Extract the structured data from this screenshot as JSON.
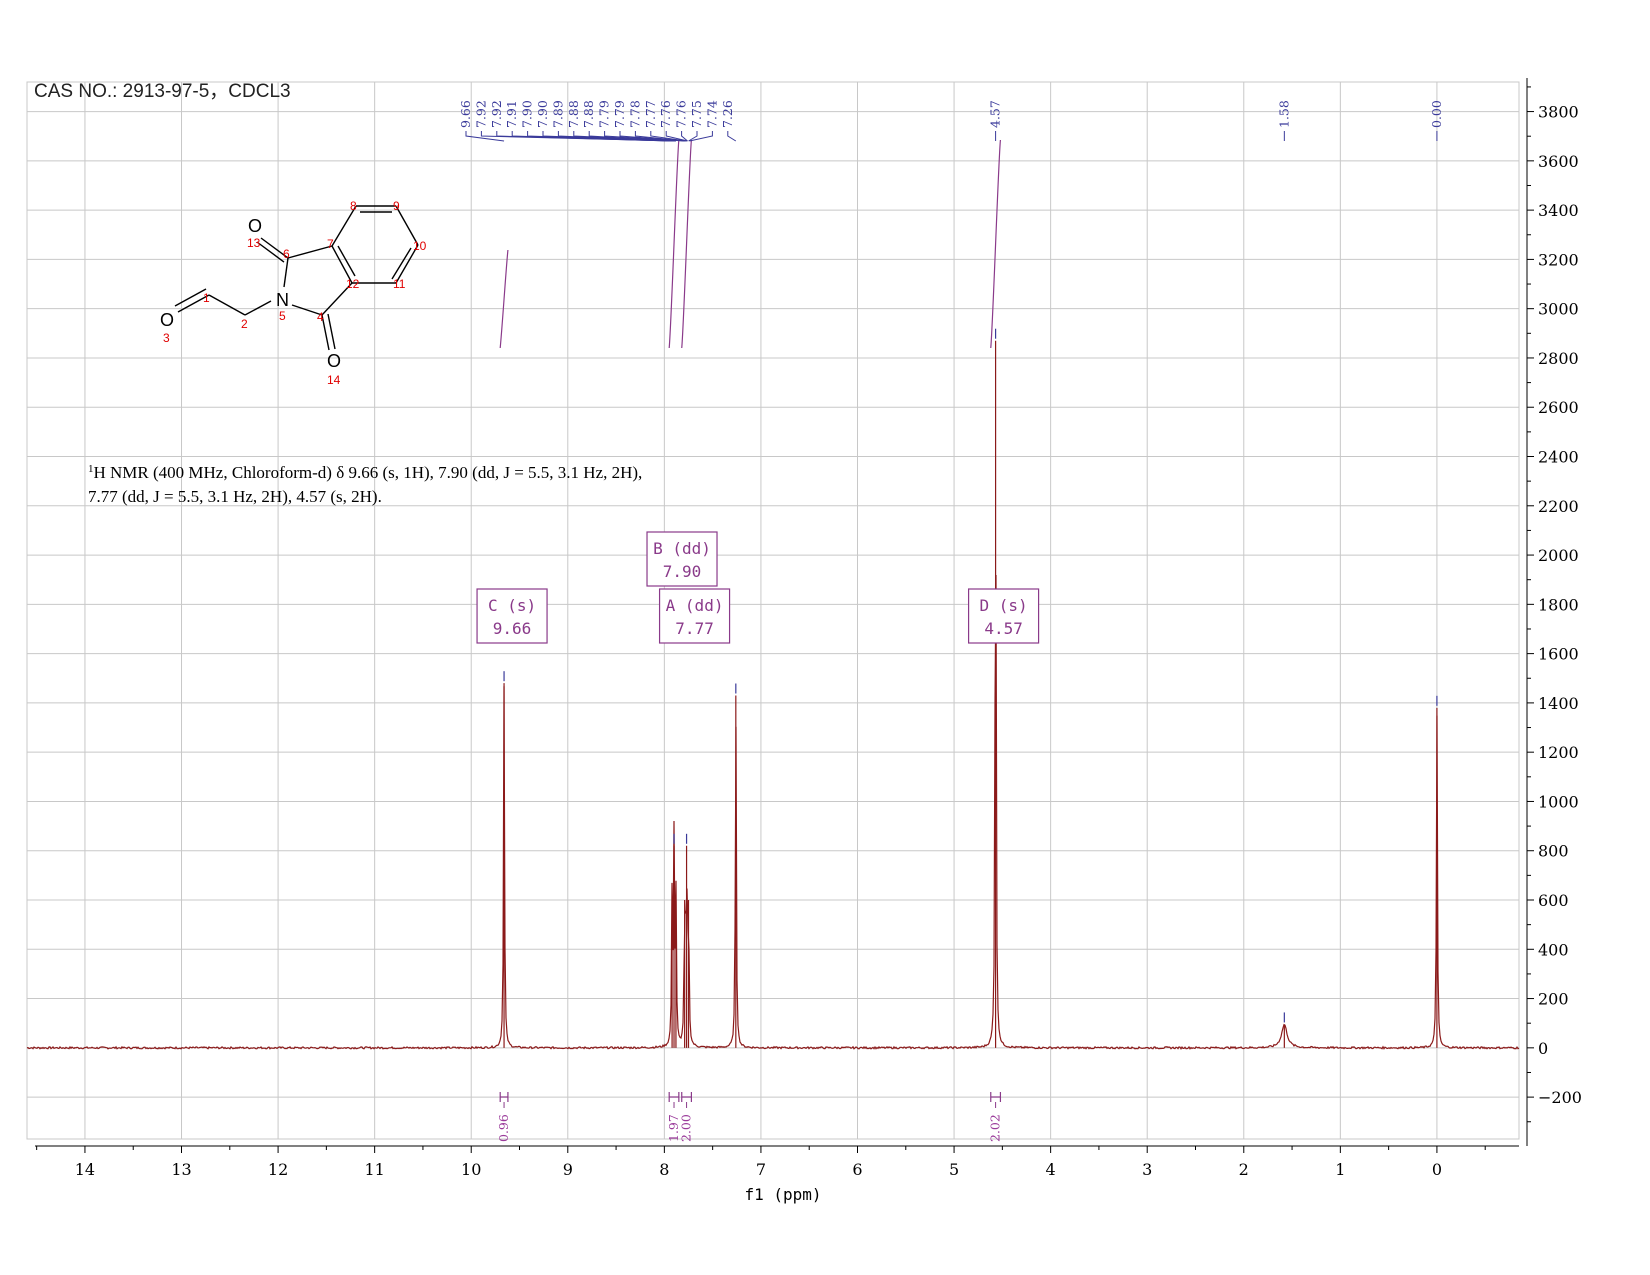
{
  "title": "CAS NO.: 2913-97-5，CDCL3",
  "nmr_description": {
    "line1": "H NMR (400 MHz, Chloroform-d) δ 9.66 (s, 1H), 7.90 (dd, J = 5.5, 3.1 Hz, 2H),",
    "line1_superscript": "1",
    "line2": "7.77 (dd, J = 5.5, 3.1 Hz, 2H), 4.57 (s, 2H)."
  },
  "molecule": {
    "atoms": [
      "O",
      "O",
      "O",
      "N"
    ],
    "numbers": [
      "1",
      "2",
      "3",
      "4",
      "5",
      "6",
      "7",
      "8",
      "9",
      "10",
      "11",
      "12",
      "13",
      "14"
    ]
  },
  "colors": {
    "spectrum": "#8b1a1a",
    "peak_label": "#3a3a9a",
    "integral": "#9a3a9a",
    "grid": "#c8c8c8",
    "atom_number": "#e00000"
  },
  "chart_data": {
    "type": "line",
    "xlabel": "f1 (ppm)",
    "xlim": [
      14.6,
      -0.85
    ],
    "ylim": [
      -370,
      3920
    ],
    "x_reversed": true,
    "x_ticks": [
      "14",
      "13",
      "12",
      "11",
      "10",
      "9",
      "8",
      "7",
      "6",
      "5",
      "4",
      "3",
      "2",
      "1",
      "0"
    ],
    "y_ticks": [
      "3800",
      "3600",
      "3400",
      "3200",
      "3000",
      "2800",
      "2600",
      "2400",
      "2200",
      "2000",
      "1800",
      "1600",
      "1400",
      "1200",
      "1000",
      "800",
      "600",
      "400",
      "200",
      "0",
      "−200"
    ],
    "grid": true,
    "peaks": [
      {
        "ppm": 9.66,
        "height": 1480
      },
      {
        "ppm": 7.92,
        "height": 600
      },
      {
        "ppm": 7.9,
        "height": 820
      },
      {
        "ppm": 7.88,
        "height": 600
      },
      {
        "ppm": 7.79,
        "height": 600
      },
      {
        "ppm": 7.77,
        "height": 820
      },
      {
        "ppm": 7.75,
        "height": 600
      },
      {
        "ppm": 7.26,
        "height": 1430
      },
      {
        "ppm": 4.57,
        "height": 2870
      },
      {
        "ppm": 1.58,
        "height": 95
      },
      {
        "ppm": 0.0,
        "height": 1380
      }
    ],
    "peak_labels": {
      "group1": [
        "9.66",
        "7.92",
        "7.92",
        "7.91",
        "7.90",
        "7.90",
        "7.89",
        "7.88",
        "7.88",
        "7.79",
        "7.79",
        "7.78",
        "7.77",
        "7.76",
        "7.76",
        "7.75",
        "7.74",
        "7.26"
      ],
      "single": [
        {
          "text": "4.57",
          "ppm": 4.57
        },
        {
          "text": "1.58",
          "ppm": 1.58
        },
        {
          "text": "0.00",
          "ppm": 0.0
        }
      ]
    },
    "multiplets": [
      {
        "line1": "C (s)",
        "line2": "9.66",
        "ppm": 9.66,
        "row": 2
      },
      {
        "line1": "B (dd)",
        "line2": "7.90",
        "ppm": 7.9,
        "row": 1
      },
      {
        "line1": "A (dd)",
        "line2": "7.77",
        "ppm": 7.77,
        "row": 2
      },
      {
        "line1": "D (s)",
        "line2": "4.57",
        "ppm": 4.57,
        "row": 2
      }
    ],
    "integrals": [
      {
        "ppm_from": 9.7,
        "ppm_to": 9.62,
        "value": "0.96"
      },
      {
        "ppm_from": 7.95,
        "ppm_to": 7.85,
        "value": "1.97"
      },
      {
        "ppm_from": 7.82,
        "ppm_to": 7.72,
        "value": "2.00"
      },
      {
        "ppm_from": 4.62,
        "ppm_to": 4.52,
        "value": "2.02"
      }
    ]
  }
}
